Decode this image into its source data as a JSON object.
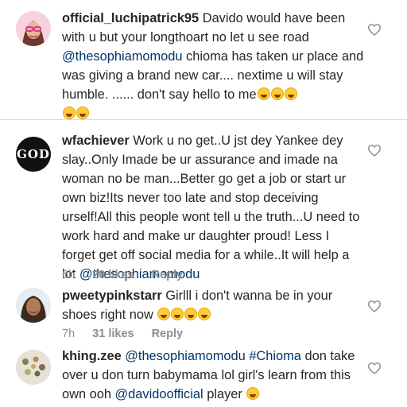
{
  "comments": [
    {
      "username": "official_luchipatrick95",
      "text_parts": [
        "Davido would have been with u but your longthoart no let u see road ",
        "@thesophiamomodu",
        " chioma has taken ur place and was giving a brand new car.... nextime u will stay humble. ...... don't say hello to me"
      ],
      "emoji_inline": "laughing-emoji x3",
      "emoji_after": "laughing-emoji x2"
    },
    {
      "username": "wfachiever",
      "avatar_text": "GOD",
      "text_parts": [
        "Work u no get..U jst dey Yankee dey slay..Only Imade be ur assurance and imade na woman no be man...Better go get a job or start ur own biz!Its never too late and stop deceiving urself!All this people wont tell u the truth...U need to work hard and make ur daughter proud! Less I forget get off social media for a while..It will help a lot ",
        "@thesophiamomodu"
      ],
      "time": "6h",
      "likes": "20 likes",
      "reply": "Reply"
    },
    {
      "username": "pweetypinkstarr",
      "text_parts": [
        "Girlll i don't wanna be in your shoes right now"
      ],
      "emoji_inline": "rofl-emoji x4",
      "time": "7h",
      "likes": "31 likes",
      "reply": "Reply"
    },
    {
      "username": "khing.zee",
      "text_parts": [
        "@thesophiamomodu",
        " ",
        "#Chioma",
        " don take over u don turn babymama lol  girl's learn from this own ooh ",
        "@davidoofficial",
        " player"
      ],
      "emoji_inline": "rofl-emoji x1"
    }
  ],
  "icons": {
    "like": "heart-outline-icon"
  },
  "colors": {
    "mention": "#003569",
    "meta": "#8e8e8e",
    "text": "#262626",
    "divider": "#dbdbdb"
  }
}
